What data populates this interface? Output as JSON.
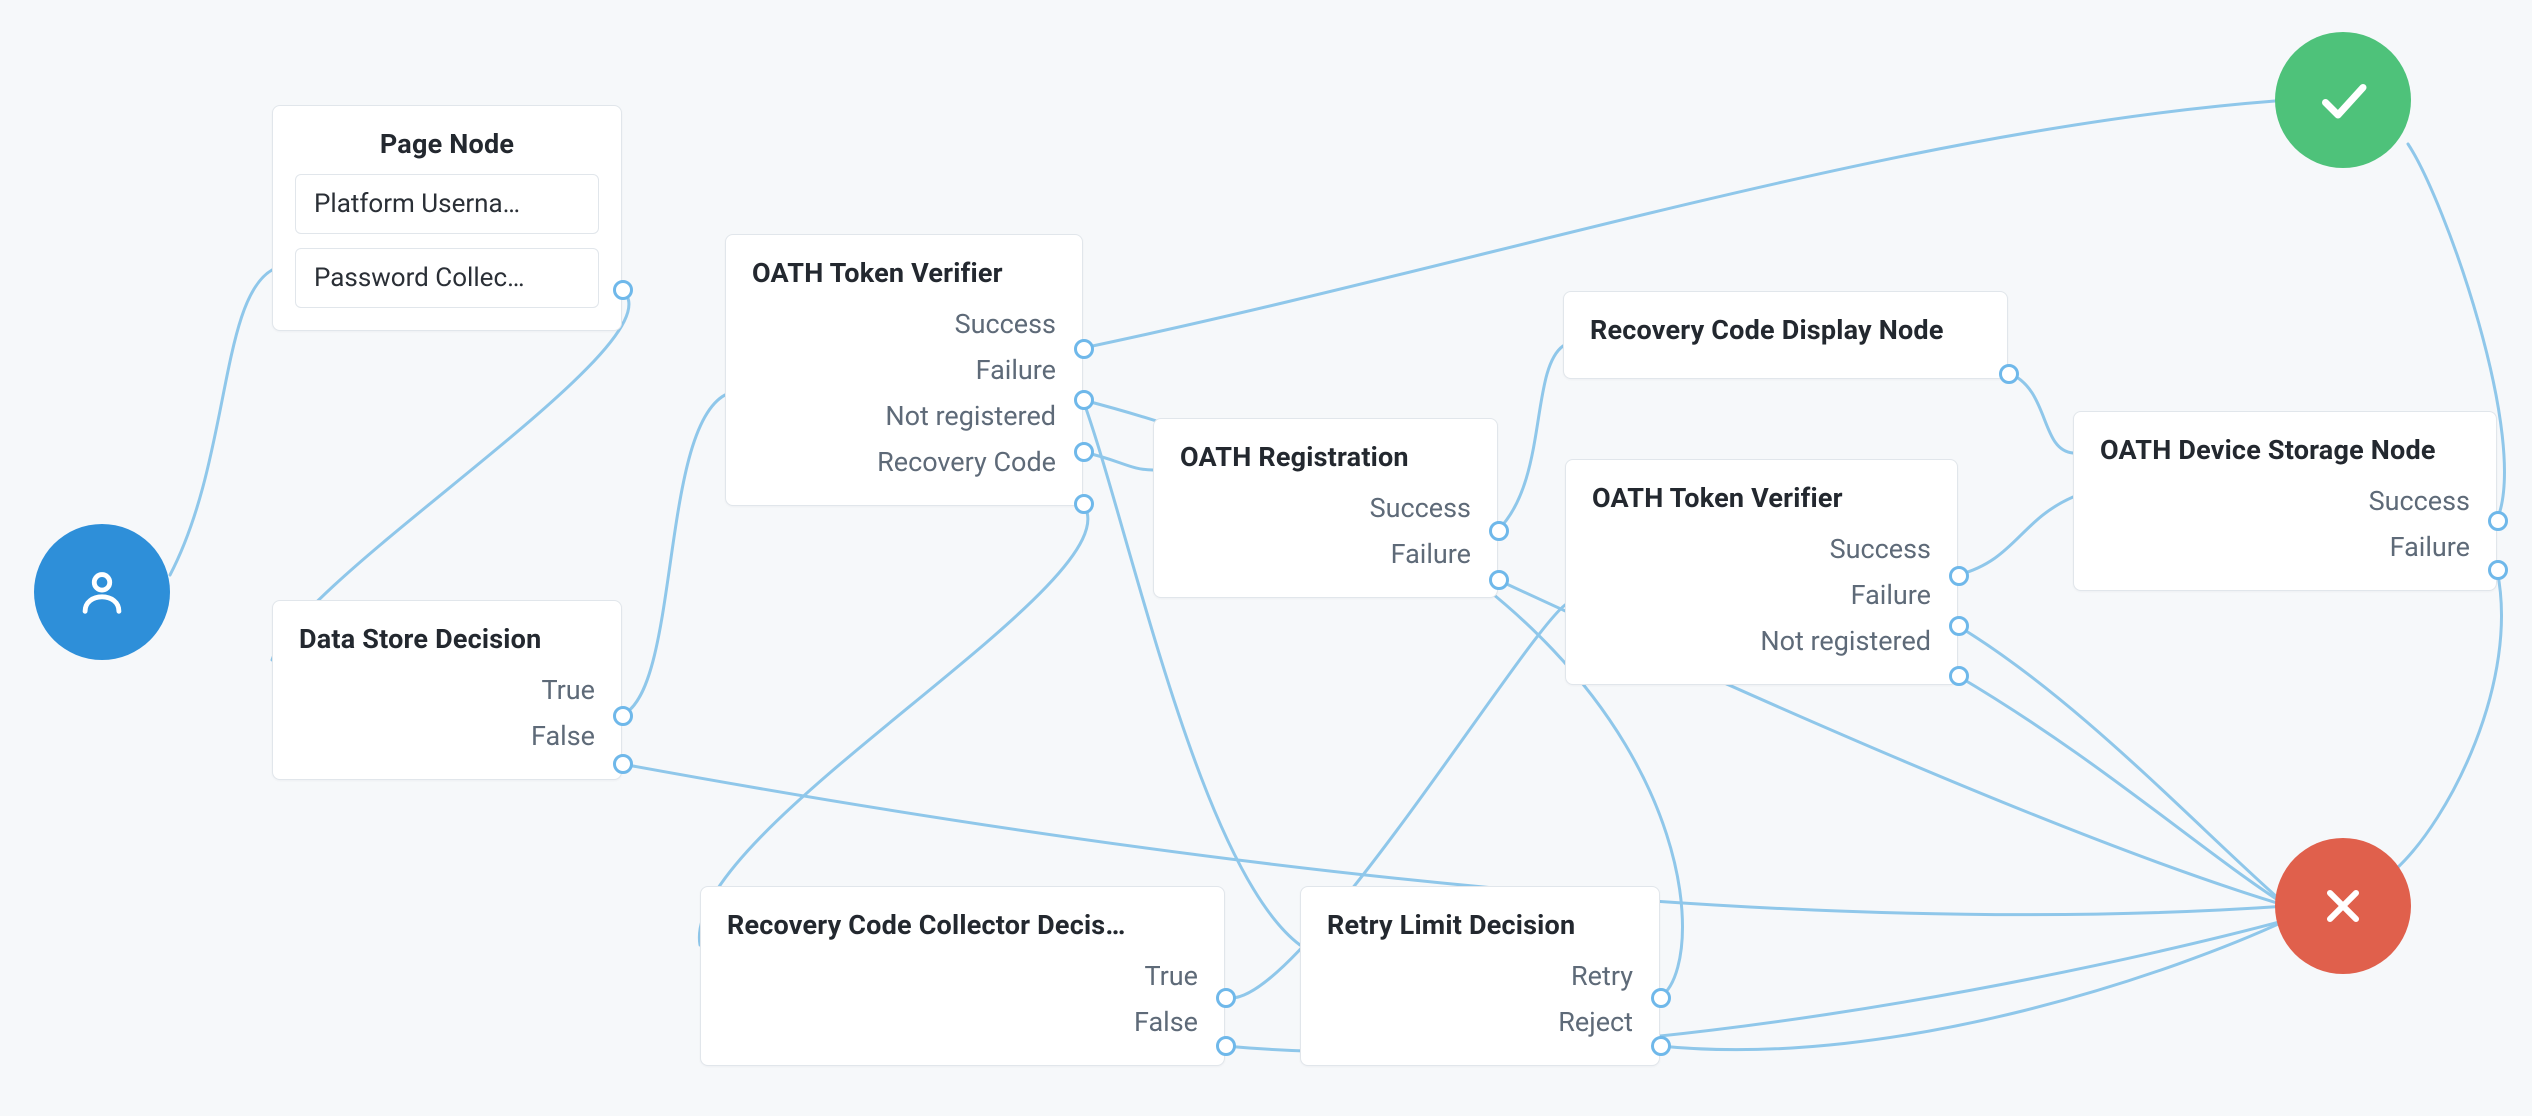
{
  "colors": {
    "background": "#f6f8fa",
    "nodeBorder": "#e1e6eb",
    "edge": "#8fc7ea",
    "portStroke": "#6fb8ea",
    "start": "#2e8fd9",
    "success": "#4ec27a",
    "failure": "#e0604c",
    "textPrimary": "#23282f",
    "textSecondary": "#5e6a78"
  },
  "glyphs": {
    "start": "person-icon",
    "success": "check-icon",
    "failure": "x-icon"
  },
  "nodes": {
    "pageNode": {
      "title": "Page Node",
      "children": [
        "Platform Userna…",
        "Password Collec…"
      ]
    },
    "dataStore": {
      "title": "Data Store Decision",
      "outcomes": [
        "True",
        "False"
      ]
    },
    "oathVerifier1": {
      "title": "OATH Token Verifier",
      "outcomes": [
        "Success",
        "Failure",
        "Not registered",
        "Recovery Code"
      ]
    },
    "oathRegistration": {
      "title": "OATH Registration",
      "outcomes": [
        "Success",
        "Failure"
      ]
    },
    "recoveryDisplay": {
      "title": "Recovery Code Display Node"
    },
    "oathVerifier2": {
      "title": "OATH Token Verifier",
      "outcomes": [
        "Success",
        "Failure",
        "Not registered"
      ]
    },
    "oathStorage": {
      "title": "OATH Device Storage Node",
      "outcomes": [
        "Success",
        "Failure"
      ]
    },
    "recoveryCollector": {
      "title": "Recovery Code Collector Decis…",
      "outcomes": [
        "True",
        "False"
      ]
    },
    "retryLimit": {
      "title": "Retry Limit Decision",
      "outcomes": [
        "Retry",
        "Reject"
      ]
    }
  },
  "chart_data": {
    "type": "flowgraph",
    "nodes": [
      {
        "id": "start",
        "type": "start"
      },
      {
        "id": "pageNode",
        "type": "box",
        "title": "Page Node",
        "children": [
          "Platform Username…",
          "Password Collector…"
        ]
      },
      {
        "id": "dataStore",
        "type": "box",
        "title": "Data Store Decision",
        "outcomes": [
          "True",
          "False"
        ]
      },
      {
        "id": "oathVerifier1",
        "type": "box",
        "title": "OATH Token Verifier",
        "outcomes": [
          "Success",
          "Failure",
          "Not registered",
          "Recovery Code"
        ]
      },
      {
        "id": "oathRegistration",
        "type": "box",
        "title": "OATH Registration",
        "outcomes": [
          "Success",
          "Failure"
        ]
      },
      {
        "id": "recoveryDisplay",
        "type": "box",
        "title": "Recovery Code Display Node"
      },
      {
        "id": "oathVerifier2",
        "type": "box",
        "title": "OATH Token Verifier",
        "outcomes": [
          "Success",
          "Failure",
          "Not registered"
        ]
      },
      {
        "id": "oathStorage",
        "type": "box",
        "title": "OATH Device Storage Node",
        "outcomes": [
          "Success",
          "Failure"
        ]
      },
      {
        "id": "recoveryCollector",
        "type": "box",
        "title": "Recovery Code Collector Decision",
        "outcomes": [
          "True",
          "False"
        ]
      },
      {
        "id": "retryLimit",
        "type": "box",
        "title": "Retry Limit Decision",
        "outcomes": [
          "Retry",
          "Reject"
        ]
      },
      {
        "id": "success",
        "type": "success"
      },
      {
        "id": "failure",
        "type": "failure"
      }
    ],
    "edges": [
      {
        "from": "start",
        "to": "pageNode"
      },
      {
        "from": "pageNode",
        "to": "dataStore"
      },
      {
        "from": "dataStore",
        "outcome": "True",
        "to": "oathVerifier1"
      },
      {
        "from": "dataStore",
        "outcome": "False",
        "to": "failure"
      },
      {
        "from": "oathVerifier1",
        "outcome": "Success",
        "to": "success"
      },
      {
        "from": "oathVerifier1",
        "outcome": "Failure",
        "to": "retryLimit"
      },
      {
        "from": "oathVerifier1",
        "outcome": "Not registered",
        "to": "oathRegistration"
      },
      {
        "from": "oathVerifier1",
        "outcome": "Recovery Code",
        "to": "recoveryCollector"
      },
      {
        "from": "oathRegistration",
        "outcome": "Success",
        "to": "recoveryDisplay"
      },
      {
        "from": "oathRegistration",
        "outcome": "Failure",
        "to": "failure"
      },
      {
        "from": "recoveryDisplay",
        "to": "oathStorage"
      },
      {
        "from": "oathVerifier2",
        "outcome": "Success",
        "to": "oathStorage"
      },
      {
        "from": "oathVerifier2",
        "outcome": "Failure",
        "to": "failure"
      },
      {
        "from": "oathVerifier2",
        "outcome": "Not registered",
        "to": "failure"
      },
      {
        "from": "oathStorage",
        "outcome": "Success",
        "to": "success"
      },
      {
        "from": "oathStorage",
        "outcome": "Failure",
        "to": "failure"
      },
      {
        "from": "recoveryCollector",
        "outcome": "True",
        "to": "oathVerifier2"
      },
      {
        "from": "recoveryCollector",
        "outcome": "False",
        "to": "failure"
      },
      {
        "from": "retryLimit",
        "outcome": "Retry",
        "to": "oathVerifier1"
      },
      {
        "from": "retryLimit",
        "outcome": "Reject",
        "to": "failure"
      }
    ]
  }
}
